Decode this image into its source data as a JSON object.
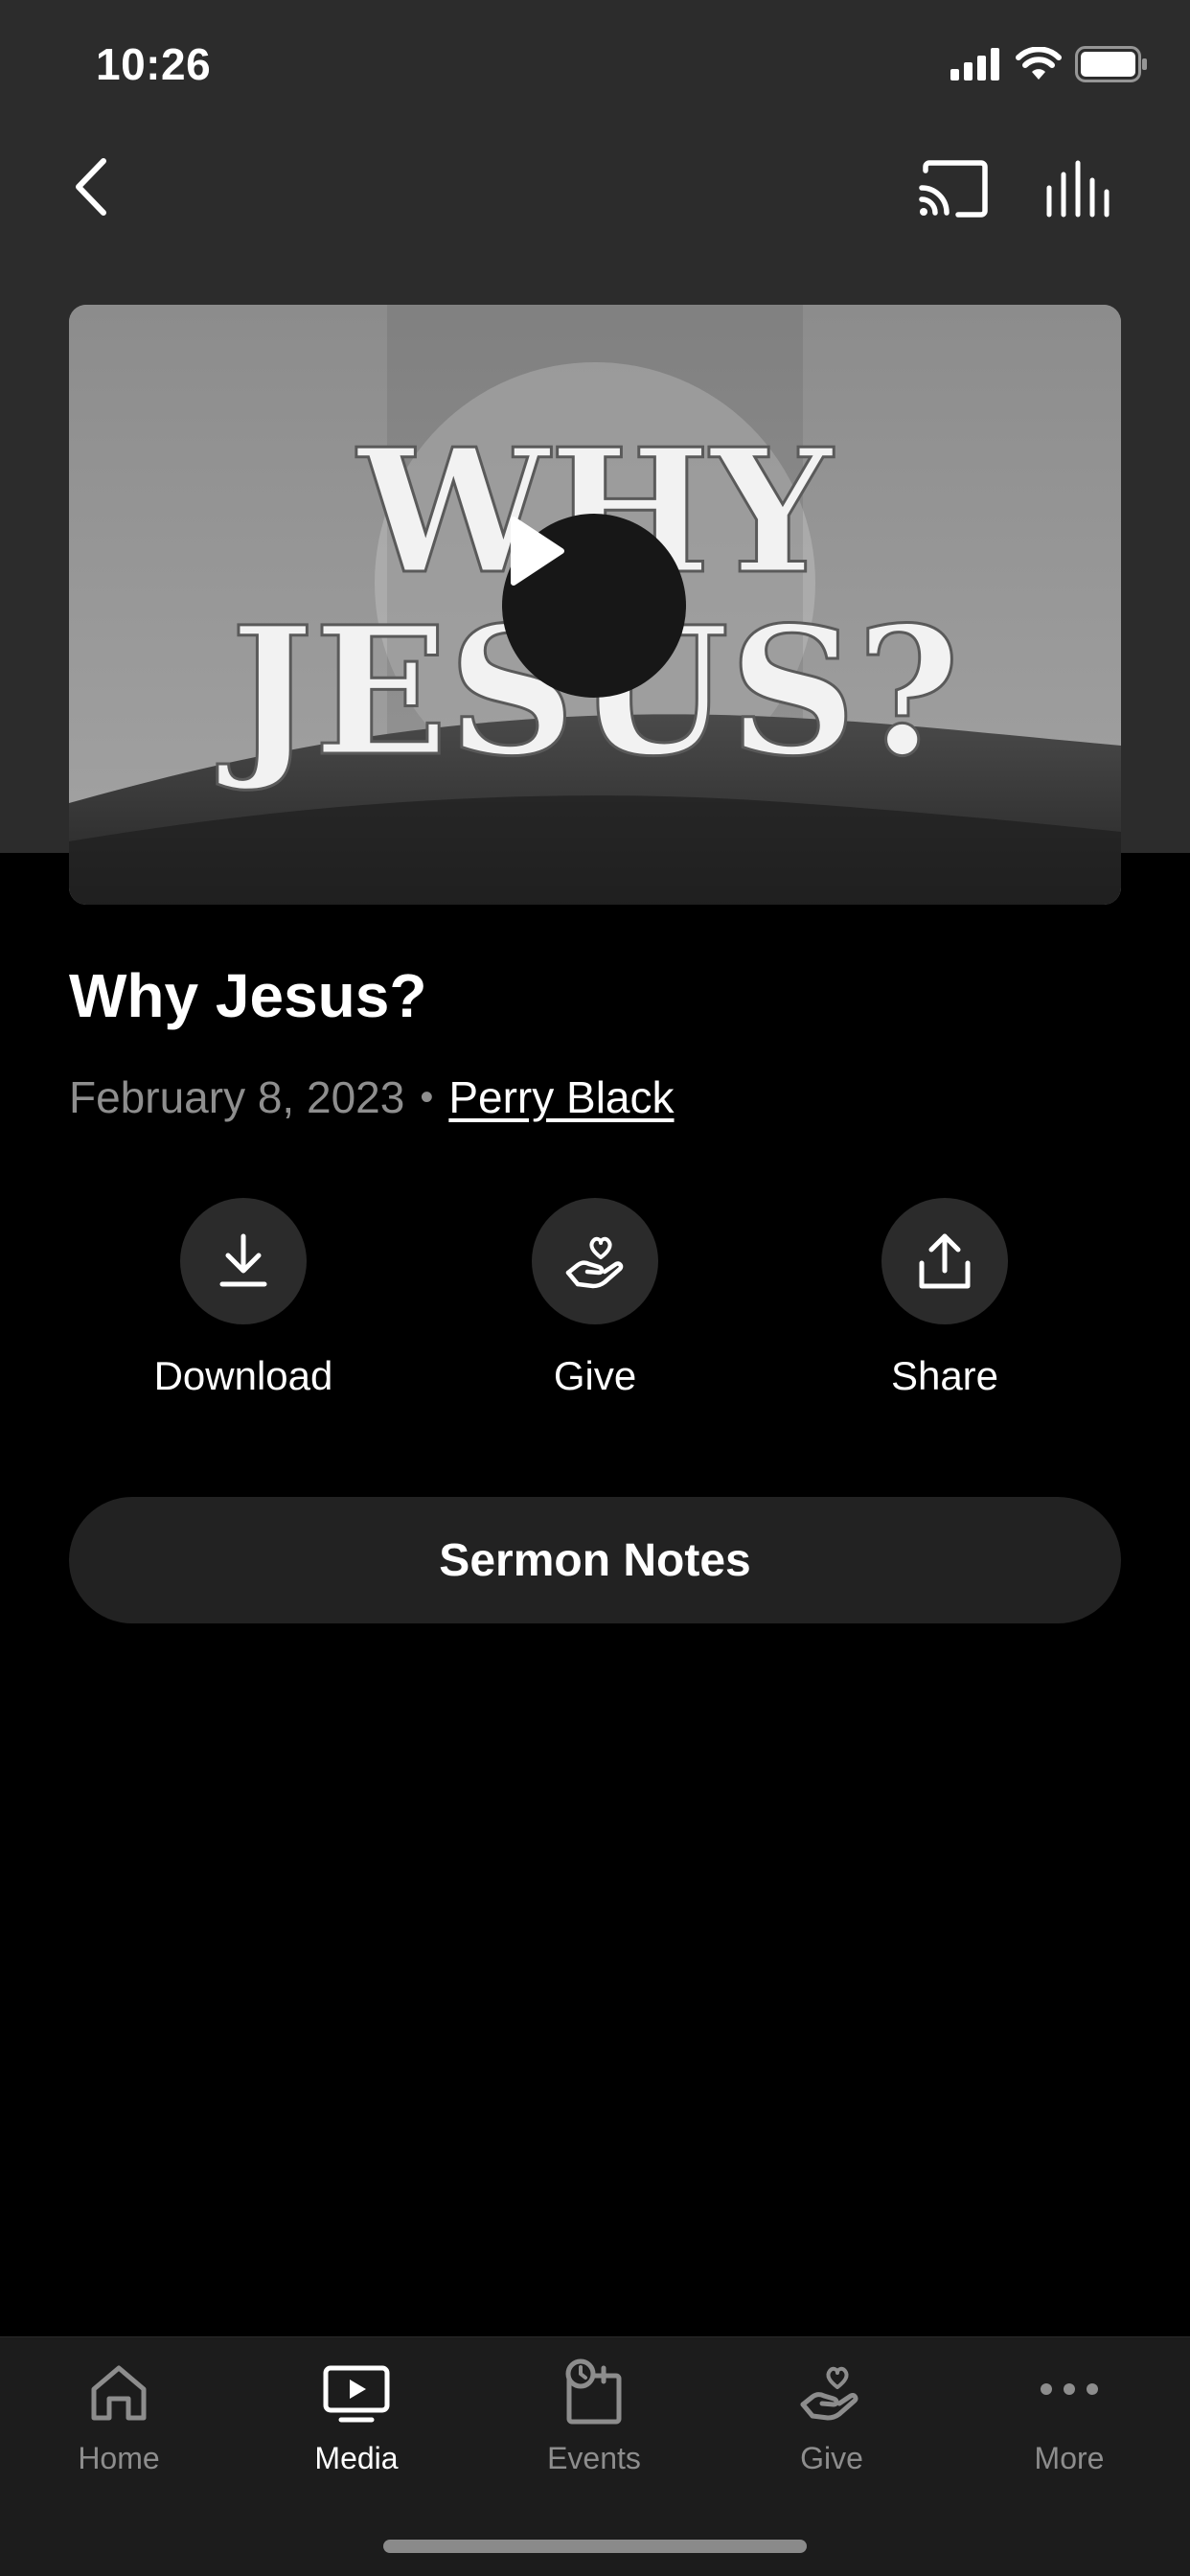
{
  "status_bar": {
    "time": "10:26"
  },
  "hero": {
    "artwork_text_line1": "WHY",
    "artwork_text_line2": "JESUS?"
  },
  "sermon": {
    "title": "Why Jesus?",
    "date": "February 8, 2023",
    "separator": "•",
    "speaker": "Perry Black"
  },
  "actions": [
    {
      "label": "Download",
      "icon": "download-icon"
    },
    {
      "label": "Give",
      "icon": "give-hand-heart-icon"
    },
    {
      "label": "Share",
      "icon": "share-icon"
    }
  ],
  "notes_button": {
    "label": "Sermon Notes"
  },
  "tab_bar": {
    "tabs": [
      {
        "label": "Home",
        "icon": "home-icon",
        "active": false
      },
      {
        "label": "Media",
        "icon": "media-icon",
        "active": true
      },
      {
        "label": "Events",
        "icon": "events-icon",
        "active": false
      },
      {
        "label": "Give",
        "icon": "give-icon",
        "active": false
      },
      {
        "label": "More",
        "icon": "more-icon",
        "active": false
      }
    ]
  },
  "colors": {
    "background": "#000000",
    "header_background": "#2c2c2c",
    "button_fill": "#2b2b2b",
    "muted_text": "#8e8e8e",
    "tab_bar": "#1c1c1c"
  }
}
